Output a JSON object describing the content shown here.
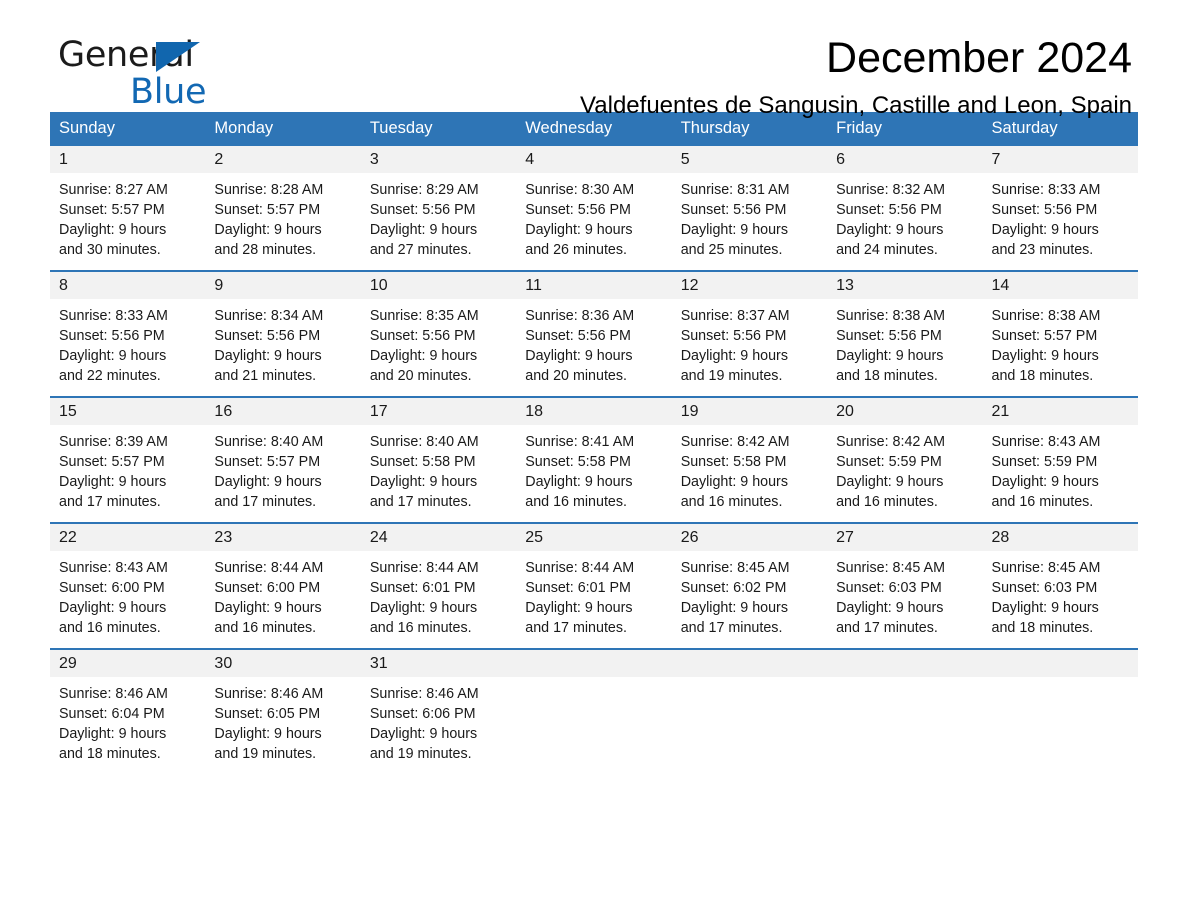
{
  "brand": {
    "word1": "General",
    "word2": "Blue",
    "triangle_color": "#1166ae",
    "blue_color": "#1268b3"
  },
  "header": {
    "title": "December 2024",
    "subtitle": "Valdefuentes de Sangusin, Castille and Leon, Spain"
  },
  "theme": {
    "header_bg": "#2e75b6",
    "row_divider": "#2e75b6",
    "daynum_bg": "#f2f2f2",
    "text": "#1a1a1a"
  },
  "weekday_headers": [
    "Sunday",
    "Monday",
    "Tuesday",
    "Wednesday",
    "Thursday",
    "Friday",
    "Saturday"
  ],
  "weeks": [
    [
      {
        "day": "1",
        "sunrise": "Sunrise: 8:27 AM",
        "sunset": "Sunset: 5:57 PM",
        "daylight_1": "Daylight: 9 hours",
        "daylight_2": "and 30 minutes."
      },
      {
        "day": "2",
        "sunrise": "Sunrise: 8:28 AM",
        "sunset": "Sunset: 5:57 PM",
        "daylight_1": "Daylight: 9 hours",
        "daylight_2": "and 28 minutes."
      },
      {
        "day": "3",
        "sunrise": "Sunrise: 8:29 AM",
        "sunset": "Sunset: 5:56 PM",
        "daylight_1": "Daylight: 9 hours",
        "daylight_2": "and 27 minutes."
      },
      {
        "day": "4",
        "sunrise": "Sunrise: 8:30 AM",
        "sunset": "Sunset: 5:56 PM",
        "daylight_1": "Daylight: 9 hours",
        "daylight_2": "and 26 minutes."
      },
      {
        "day": "5",
        "sunrise": "Sunrise: 8:31 AM",
        "sunset": "Sunset: 5:56 PM",
        "daylight_1": "Daylight: 9 hours",
        "daylight_2": "and 25 minutes."
      },
      {
        "day": "6",
        "sunrise": "Sunrise: 8:32 AM",
        "sunset": "Sunset: 5:56 PM",
        "daylight_1": "Daylight: 9 hours",
        "daylight_2": "and 24 minutes."
      },
      {
        "day": "7",
        "sunrise": "Sunrise: 8:33 AM",
        "sunset": "Sunset: 5:56 PM",
        "daylight_1": "Daylight: 9 hours",
        "daylight_2": "and 23 minutes."
      }
    ],
    [
      {
        "day": "8",
        "sunrise": "Sunrise: 8:33 AM",
        "sunset": "Sunset: 5:56 PM",
        "daylight_1": "Daylight: 9 hours",
        "daylight_2": "and 22 minutes."
      },
      {
        "day": "9",
        "sunrise": "Sunrise: 8:34 AM",
        "sunset": "Sunset: 5:56 PM",
        "daylight_1": "Daylight: 9 hours",
        "daylight_2": "and 21 minutes."
      },
      {
        "day": "10",
        "sunrise": "Sunrise: 8:35 AM",
        "sunset": "Sunset: 5:56 PM",
        "daylight_1": "Daylight: 9 hours",
        "daylight_2": "and 20 minutes."
      },
      {
        "day": "11",
        "sunrise": "Sunrise: 8:36 AM",
        "sunset": "Sunset: 5:56 PM",
        "daylight_1": "Daylight: 9 hours",
        "daylight_2": "and 20 minutes."
      },
      {
        "day": "12",
        "sunrise": "Sunrise: 8:37 AM",
        "sunset": "Sunset: 5:56 PM",
        "daylight_1": "Daylight: 9 hours",
        "daylight_2": "and 19 minutes."
      },
      {
        "day": "13",
        "sunrise": "Sunrise: 8:38 AM",
        "sunset": "Sunset: 5:56 PM",
        "daylight_1": "Daylight: 9 hours",
        "daylight_2": "and 18 minutes."
      },
      {
        "day": "14",
        "sunrise": "Sunrise: 8:38 AM",
        "sunset": "Sunset: 5:57 PM",
        "daylight_1": "Daylight: 9 hours",
        "daylight_2": "and 18 minutes."
      }
    ],
    [
      {
        "day": "15",
        "sunrise": "Sunrise: 8:39 AM",
        "sunset": "Sunset: 5:57 PM",
        "daylight_1": "Daylight: 9 hours",
        "daylight_2": "and 17 minutes."
      },
      {
        "day": "16",
        "sunrise": "Sunrise: 8:40 AM",
        "sunset": "Sunset: 5:57 PM",
        "daylight_1": "Daylight: 9 hours",
        "daylight_2": "and 17 minutes."
      },
      {
        "day": "17",
        "sunrise": "Sunrise: 8:40 AM",
        "sunset": "Sunset: 5:58 PM",
        "daylight_1": "Daylight: 9 hours",
        "daylight_2": "and 17 minutes."
      },
      {
        "day": "18",
        "sunrise": "Sunrise: 8:41 AM",
        "sunset": "Sunset: 5:58 PM",
        "daylight_1": "Daylight: 9 hours",
        "daylight_2": "and 16 minutes."
      },
      {
        "day": "19",
        "sunrise": "Sunrise: 8:42 AM",
        "sunset": "Sunset: 5:58 PM",
        "daylight_1": "Daylight: 9 hours",
        "daylight_2": "and 16 minutes."
      },
      {
        "day": "20",
        "sunrise": "Sunrise: 8:42 AM",
        "sunset": "Sunset: 5:59 PM",
        "daylight_1": "Daylight: 9 hours",
        "daylight_2": "and 16 minutes."
      },
      {
        "day": "21",
        "sunrise": "Sunrise: 8:43 AM",
        "sunset": "Sunset: 5:59 PM",
        "daylight_1": "Daylight: 9 hours",
        "daylight_2": "and 16 minutes."
      }
    ],
    [
      {
        "day": "22",
        "sunrise": "Sunrise: 8:43 AM",
        "sunset": "Sunset: 6:00 PM",
        "daylight_1": "Daylight: 9 hours",
        "daylight_2": "and 16 minutes."
      },
      {
        "day": "23",
        "sunrise": "Sunrise: 8:44 AM",
        "sunset": "Sunset: 6:00 PM",
        "daylight_1": "Daylight: 9 hours",
        "daylight_2": "and 16 minutes."
      },
      {
        "day": "24",
        "sunrise": "Sunrise: 8:44 AM",
        "sunset": "Sunset: 6:01 PM",
        "daylight_1": "Daylight: 9 hours",
        "daylight_2": "and 16 minutes."
      },
      {
        "day": "25",
        "sunrise": "Sunrise: 8:44 AM",
        "sunset": "Sunset: 6:01 PM",
        "daylight_1": "Daylight: 9 hours",
        "daylight_2": "and 17 minutes."
      },
      {
        "day": "26",
        "sunrise": "Sunrise: 8:45 AM",
        "sunset": "Sunset: 6:02 PM",
        "daylight_1": "Daylight: 9 hours",
        "daylight_2": "and 17 minutes."
      },
      {
        "day": "27",
        "sunrise": "Sunrise: 8:45 AM",
        "sunset": "Sunset: 6:03 PM",
        "daylight_1": "Daylight: 9 hours",
        "daylight_2": "and 17 minutes."
      },
      {
        "day": "28",
        "sunrise": "Sunrise: 8:45 AM",
        "sunset": "Sunset: 6:03 PM",
        "daylight_1": "Daylight: 9 hours",
        "daylight_2": "and 18 minutes."
      }
    ],
    [
      {
        "day": "29",
        "sunrise": "Sunrise: 8:46 AM",
        "sunset": "Sunset: 6:04 PM",
        "daylight_1": "Daylight: 9 hours",
        "daylight_2": "and 18 minutes."
      },
      {
        "day": "30",
        "sunrise": "Sunrise: 8:46 AM",
        "sunset": "Sunset: 6:05 PM",
        "daylight_1": "Daylight: 9 hours",
        "daylight_2": "and 19 minutes."
      },
      {
        "day": "31",
        "sunrise": "Sunrise: 8:46 AM",
        "sunset": "Sunset: 6:06 PM",
        "daylight_1": "Daylight: 9 hours",
        "daylight_2": "and 19 minutes."
      },
      {
        "day": "",
        "sunrise": "",
        "sunset": "",
        "daylight_1": "",
        "daylight_2": ""
      },
      {
        "day": "",
        "sunrise": "",
        "sunset": "",
        "daylight_1": "",
        "daylight_2": ""
      },
      {
        "day": "",
        "sunrise": "",
        "sunset": "",
        "daylight_1": "",
        "daylight_2": ""
      },
      {
        "day": "",
        "sunrise": "",
        "sunset": "",
        "daylight_1": "",
        "daylight_2": ""
      }
    ]
  ]
}
